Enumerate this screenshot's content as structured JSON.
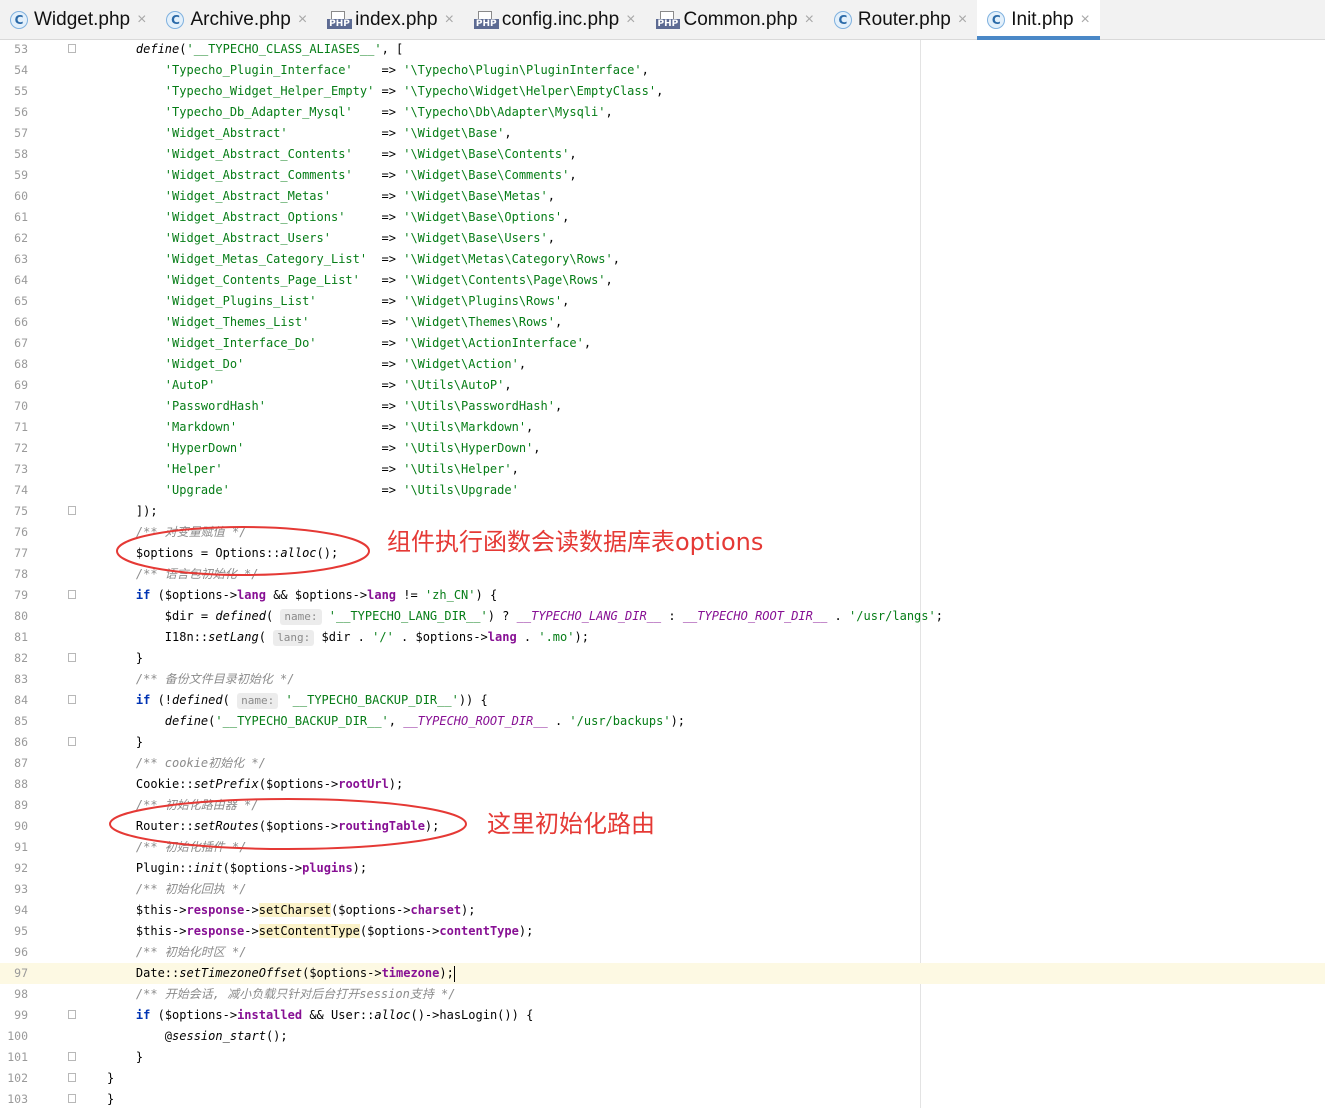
{
  "tabs": [
    {
      "label": "Widget.php",
      "icon": "php-class-icon",
      "icon_text": "C",
      "active": false
    },
    {
      "label": "Archive.php",
      "icon": "php-class-icon",
      "icon_text": "C",
      "active": false
    },
    {
      "label": "index.php",
      "icon": "php-file-icon",
      "icon_text": "PHP",
      "active": false
    },
    {
      "label": "config.inc.php",
      "icon": "php-file-icon",
      "icon_text": "PHP",
      "active": false
    },
    {
      "label": "Common.php",
      "icon": "php-file-icon",
      "icon_text": "PHP",
      "active": false
    },
    {
      "label": "Router.php",
      "icon": "php-class-icon",
      "icon_text": "C",
      "active": false
    },
    {
      "label": "Init.php",
      "icon": "php-class-icon",
      "icon_text": "C",
      "active": true
    }
  ],
  "tab_close_glyph": "×",
  "current_line": 97,
  "lines": [
    {
      "n": "53",
      "fold": true,
      "html": "    <span class=\"t-fn\">define</span>(<span class=\"t-str\">'__TYPECHO_CLASS_ALIASES__'</span>, ["
    },
    {
      "n": "54",
      "html": "        <span class=\"t-str\">'Typecho_Plugin_Interface'</span>    => <span class=\"t-str\">'\\Typecho\\Plugin\\PluginInterface'</span>,"
    },
    {
      "n": "55",
      "html": "        <span class=\"t-str\">'Typecho_Widget_Helper_Empty'</span> => <span class=\"t-str\">'\\Typecho\\Widget\\Helper\\EmptyClass'</span>,"
    },
    {
      "n": "56",
      "html": "        <span class=\"t-str\">'Typecho_Db_Adapter_Mysql'</span>    => <span class=\"t-str\">'\\Typecho\\Db\\Adapter\\Mysqli'</span>,"
    },
    {
      "n": "57",
      "html": "        <span class=\"t-str\">'Widget_Abstract'</span>             => <span class=\"t-str\">'\\Widget\\Base'</span>,"
    },
    {
      "n": "58",
      "html": "        <span class=\"t-str\">'Widget_Abstract_Contents'</span>    => <span class=\"t-str\">'\\Widget\\Base\\Contents'</span>,"
    },
    {
      "n": "59",
      "html": "        <span class=\"t-str\">'Widget_Abstract_Comments'</span>    => <span class=\"t-str\">'\\Widget\\Base\\Comments'</span>,"
    },
    {
      "n": "60",
      "html": "        <span class=\"t-str\">'Widget_Abstract_Metas'</span>       => <span class=\"t-str\">'\\Widget\\Base\\Metas'</span>,"
    },
    {
      "n": "61",
      "html": "        <span class=\"t-str\">'Widget_Abstract_Options'</span>     => <span class=\"t-str\">'\\Widget\\Base\\Options'</span>,"
    },
    {
      "n": "62",
      "html": "        <span class=\"t-str\">'Widget_Abstract_Users'</span>       => <span class=\"t-str\">'\\Widget\\Base\\Users'</span>,"
    },
    {
      "n": "63",
      "html": "        <span class=\"t-str\">'Widget_Metas_Category_List'</span>  => <span class=\"t-str\">'\\Widget\\Metas\\Category\\Rows'</span>,"
    },
    {
      "n": "64",
      "html": "        <span class=\"t-str\">'Widget_Contents_Page_List'</span>   => <span class=\"t-str\">'\\Widget\\Contents\\Page\\Rows'</span>,"
    },
    {
      "n": "65",
      "html": "        <span class=\"t-str\">'Widget_Plugins_List'</span>         => <span class=\"t-str\">'\\Widget\\Plugins\\Rows'</span>,"
    },
    {
      "n": "66",
      "html": "        <span class=\"t-str\">'Widget_Themes_List'</span>          => <span class=\"t-str\">'\\Widget\\Themes\\Rows'</span>,"
    },
    {
      "n": "67",
      "html": "        <span class=\"t-str\">'Widget_Interface_Do'</span>         => <span class=\"t-str\">'\\Widget\\ActionInterface'</span>,"
    },
    {
      "n": "68",
      "html": "        <span class=\"t-str\">'Widget_Do'</span>                   => <span class=\"t-str\">'\\Widget\\Action'</span>,"
    },
    {
      "n": "69",
      "html": "        <span class=\"t-str\">'AutoP'</span>                       => <span class=\"t-str\">'\\Utils\\AutoP'</span>,"
    },
    {
      "n": "70",
      "html": "        <span class=\"t-str\">'PasswordHash'</span>                => <span class=\"t-str\">'\\Utils\\PasswordHash'</span>,"
    },
    {
      "n": "71",
      "html": "        <span class=\"t-str\">'Markdown'</span>                    => <span class=\"t-str\">'\\Utils\\Markdown'</span>,"
    },
    {
      "n": "72",
      "html": "        <span class=\"t-str\">'HyperDown'</span>                   => <span class=\"t-str\">'\\Utils\\HyperDown'</span>,"
    },
    {
      "n": "73",
      "html": "        <span class=\"t-str\">'Helper'</span>                      => <span class=\"t-str\">'\\Utils\\Helper'</span>,"
    },
    {
      "n": "74",
      "html": "        <span class=\"t-str\">'Upgrade'</span>                     => <span class=\"t-str\">'\\Utils\\Upgrade'</span>"
    },
    {
      "n": "75",
      "fold": true,
      "html": "    ]);"
    },
    {
      "n": "76",
      "html": "    <span class=\"t-cmt\">/** 对变量赋值 */</span>"
    },
    {
      "n": "77",
      "html": "    <span class=\"t-var\">$options</span> = Options::<span class=\"t-fn\">alloc</span>();"
    },
    {
      "n": "78",
      "html": "    <span class=\"t-cmt\">/** 语言包初始化 */</span>"
    },
    {
      "n": "79",
      "fold": true,
      "html": "    <span class=\"t-kw\">if</span> (<span class=\"t-var\">$options</span>-><span class=\"t-prop\">lang</span> && <span class=\"t-var\">$options</span>-><span class=\"t-prop\">lang</span> != <span class=\"t-str\">'zh_CN'</span>) {"
    },
    {
      "n": "80",
      "html": "        <span class=\"t-var\">$dir</span> = <span class=\"t-fn\">defined</span>( <span class=\"hint\">name:</span> <span class=\"t-str\">'__TYPECHO_LANG_DIR__'</span>) ? <span class=\"t-const\">__TYPECHO_LANG_DIR__</span> : <span class=\"t-const\">__TYPECHO_ROOT_DIR__</span> . <span class=\"t-str\">'/usr/langs'</span>;"
    },
    {
      "n": "81",
      "html": "        I18n::<span class=\"t-fn\">setLang</span>( <span class=\"hint\">lang:</span> <span class=\"t-var\">$dir</span> . <span class=\"t-str\">'/'</span> . <span class=\"t-var\">$options</span>-><span class=\"t-prop\">lang</span> . <span class=\"t-str\">'.mo'</span>);"
    },
    {
      "n": "82",
      "fold": true,
      "html": "    }"
    },
    {
      "n": "83",
      "html": "    <span class=\"t-cmt\">/** 备份文件目录初始化 */</span>"
    },
    {
      "n": "84",
      "fold": true,
      "html": "    <span class=\"t-kw\">if</span> (!<span class=\"t-fn\">defined</span>( <span class=\"hint\">name:</span> <span class=\"t-str\">'__TYPECHO_BACKUP_DIR__'</span>)) {"
    },
    {
      "n": "85",
      "html": "        <span class=\"t-fn\">define</span>(<span class=\"t-str\">'__TYPECHO_BACKUP_DIR__'</span>, <span class=\"t-const\">__TYPECHO_ROOT_DIR__</span> . <span class=\"t-str\">'/usr/backups'</span>);"
    },
    {
      "n": "86",
      "fold": true,
      "html": "    }"
    },
    {
      "n": "87",
      "html": "    <span class=\"t-cmt\">/** cookie初始化 */</span>"
    },
    {
      "n": "88",
      "html": "    Cookie::<span class=\"t-fn\">setPrefix</span>(<span class=\"t-var\">$options</span>-><span class=\"t-prop\">rootUrl</span>);"
    },
    {
      "n": "89",
      "html": "    <span class=\"t-cmt\">/** 初始化路由器 */</span>"
    },
    {
      "n": "90",
      "html": "    Router::<span class=\"t-fn\">setRoutes</span>(<span class=\"t-var\">$options</span>-><span class=\"t-prop\">routingTable</span>);"
    },
    {
      "n": "91",
      "html": "    <span class=\"t-cmt\">/** 初始化插件 */</span>"
    },
    {
      "n": "92",
      "html": "    Plugin::<span class=\"t-fn\">init</span>(<span class=\"t-var\">$options</span>-><span class=\"t-prop\">plugins</span>);"
    },
    {
      "n": "93",
      "html": "    <span class=\"t-cmt\">/** 初始化回执 */</span>"
    },
    {
      "n": "94",
      "html": "    <span class=\"t-var\">$this</span>-><span class=\"t-prop\">response</span>-><span class=\"t-hl\">setCharset</span>(<span class=\"t-var\">$options</span>-><span class=\"t-prop\">charset</span>);"
    },
    {
      "n": "95",
      "html": "    <span class=\"t-var\">$this</span>-><span class=\"t-prop\">response</span>-><span class=\"t-hl\">setContentType</span>(<span class=\"t-var\">$options</span>-><span class=\"t-prop\">contentType</span>);"
    },
    {
      "n": "96",
      "html": "    <span class=\"t-cmt\">/** 初始化时区 */</span>"
    },
    {
      "n": "97",
      "html": "    Date::<span class=\"t-fn\">setTimezoneOffset</span>(<span class=\"t-var\">$options</span>-><span class=\"t-prop\">timezone</span>);<span class=\"caret\"></span>"
    },
    {
      "n": "98",
      "html": "    <span class=\"t-cmt\">/** 开始会话, 减小负载只针对后台打开session支持 */</span>"
    },
    {
      "n": "99",
      "fold": true,
      "html": "    <span class=\"t-kw\">if</span> (<span class=\"t-var\">$options</span>-><span class=\"t-prop\">installed</span> && User::<span class=\"t-fn\">alloc</span>()->hasLogin()) {"
    },
    {
      "n": "100",
      "html": "        @<span class=\"t-fn\">session_start</span>();"
    },
    {
      "n": "101",
      "fold": true,
      "html": "    }"
    },
    {
      "n": "102",
      "fold": true,
      "html": "}"
    },
    {
      "n": "103",
      "fold": true,
      "html": "}"
    }
  ],
  "annotations": {
    "options_note": "组件执行函数会读数据库表options",
    "router_note": "这里初始化路由"
  },
  "colors": {
    "annotation_red": "#e53935",
    "active_tab_underline": "#4a88c7",
    "current_line_bg": "#fdf9e3"
  }
}
